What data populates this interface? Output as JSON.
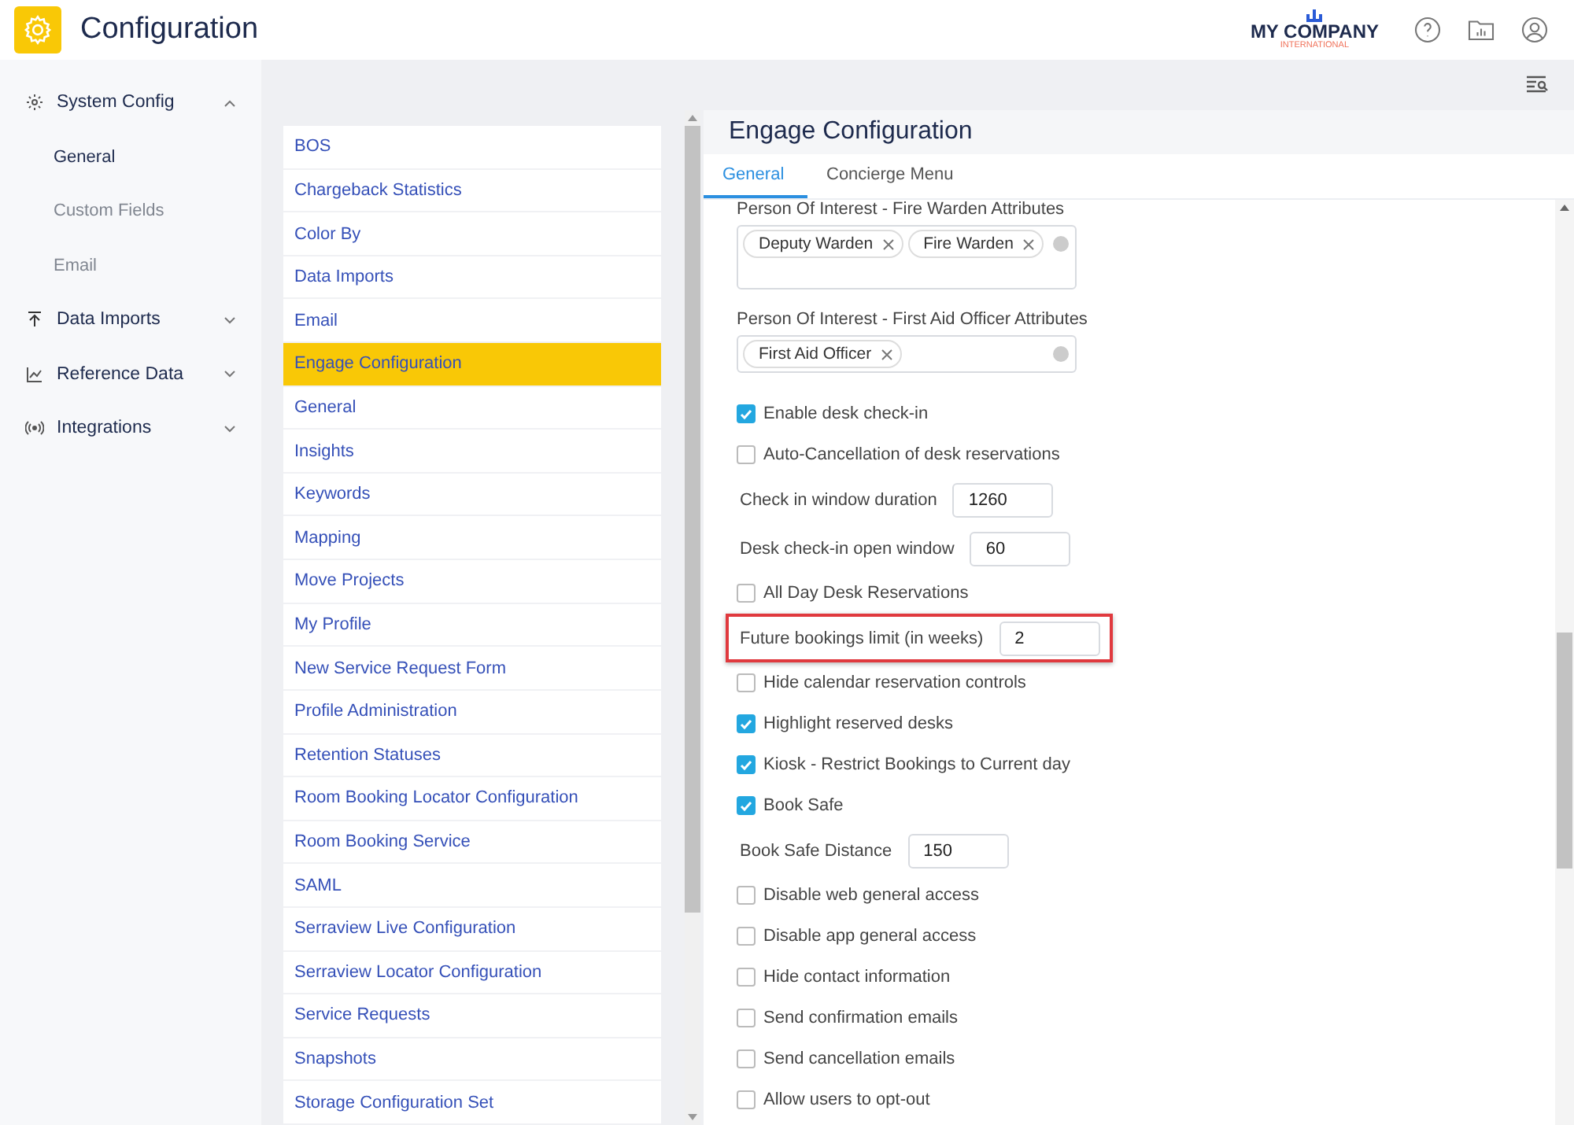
{
  "app": {
    "title": "Configuration",
    "logo": {
      "name": "MY COMPANY",
      "subtitle": "INTERNATIONAL"
    }
  },
  "sidebar": {
    "groups": [
      {
        "label": "System Config",
        "expanded": true,
        "children": [
          {
            "label": "General",
            "selected": true
          },
          {
            "label": "Custom Fields",
            "selected": false
          },
          {
            "label": "Email",
            "selected": false
          }
        ]
      },
      {
        "label": "Data Imports",
        "expanded": false
      },
      {
        "label": "Reference Data",
        "expanded": false
      },
      {
        "label": "Integrations",
        "expanded": false
      }
    ]
  },
  "list": {
    "items": [
      {
        "label": "BOS",
        "selected": false
      },
      {
        "label": "Chargeback Statistics",
        "selected": false
      },
      {
        "label": "Color By",
        "selected": false
      },
      {
        "label": "Data Imports",
        "selected": false
      },
      {
        "label": "Email",
        "selected": false
      },
      {
        "label": "Engage Configuration",
        "selected": true
      },
      {
        "label": "General",
        "selected": false
      },
      {
        "label": "Insights",
        "selected": false
      },
      {
        "label": "Keywords",
        "selected": false
      },
      {
        "label": "Mapping",
        "selected": false
      },
      {
        "label": "Move Projects",
        "selected": false
      },
      {
        "label": "My Profile",
        "selected": false
      },
      {
        "label": "New Service Request Form",
        "selected": false
      },
      {
        "label": "Profile Administration",
        "selected": false
      },
      {
        "label": "Retention Statuses",
        "selected": false
      },
      {
        "label": "Room Booking Locator Configuration",
        "selected": false
      },
      {
        "label": "Room Booking Service",
        "selected": false
      },
      {
        "label": "SAML",
        "selected": false
      },
      {
        "label": "Serraview Live Configuration",
        "selected": false
      },
      {
        "label": "Serraview Locator Configuration",
        "selected": false
      },
      {
        "label": "Service Requests",
        "selected": false
      },
      {
        "label": "Snapshots",
        "selected": false
      },
      {
        "label": "Storage Configuration Set",
        "selected": false
      }
    ]
  },
  "panel": {
    "title": "Engage Configuration",
    "tabs": [
      {
        "label": "General",
        "selected": true
      },
      {
        "label": "Concierge Menu",
        "selected": false
      }
    ],
    "fields": [
      {
        "kind": "tags",
        "label": "Person Of Interest - Fire Warden Attributes",
        "tags": [
          "Deputy Warden",
          "Fire Warden"
        ],
        "tall": true
      },
      {
        "kind": "tags",
        "label": "Person Of Interest - First Aid Officer Attributes",
        "tags": [
          "First Aid Officer"
        ],
        "tall": false
      },
      {
        "kind": "checkbox",
        "label": "Enable desk check-in",
        "checked": true
      },
      {
        "kind": "checkbox",
        "label": "Auto-Cancellation of desk reservations",
        "checked": false
      },
      {
        "kind": "number",
        "label": "Check in window duration",
        "value": "1260",
        "highlighted": false
      },
      {
        "kind": "number",
        "label": "Desk check-in open window",
        "value": "60",
        "highlighted": false
      },
      {
        "kind": "checkbox",
        "label": "All Day Desk Reservations",
        "checked": false
      },
      {
        "kind": "number",
        "label": "Future bookings limit (in weeks)",
        "value": "2",
        "highlighted": true
      },
      {
        "kind": "checkbox",
        "label": "Hide calendar reservation controls",
        "checked": false
      },
      {
        "kind": "checkbox",
        "label": "Highlight reserved desks",
        "checked": true
      },
      {
        "kind": "checkbox",
        "label": "Kiosk - Restrict Bookings to Current day",
        "checked": true
      },
      {
        "kind": "checkbox",
        "label": "Book Safe",
        "checked": true
      },
      {
        "kind": "number",
        "label": "Book Safe Distance",
        "value": "150",
        "highlighted": false
      },
      {
        "kind": "checkbox",
        "label": "Disable web general access",
        "checked": false
      },
      {
        "kind": "checkbox",
        "label": "Disable app general access",
        "checked": false
      },
      {
        "kind": "checkbox",
        "label": "Hide contact information",
        "checked": false
      },
      {
        "kind": "checkbox",
        "label": "Send confirmation emails",
        "checked": false
      },
      {
        "kind": "checkbox",
        "label": "Send cancellation emails",
        "checked": false
      },
      {
        "kind": "checkbox",
        "label": "Allow users to opt-out",
        "checked": false
      }
    ]
  }
}
